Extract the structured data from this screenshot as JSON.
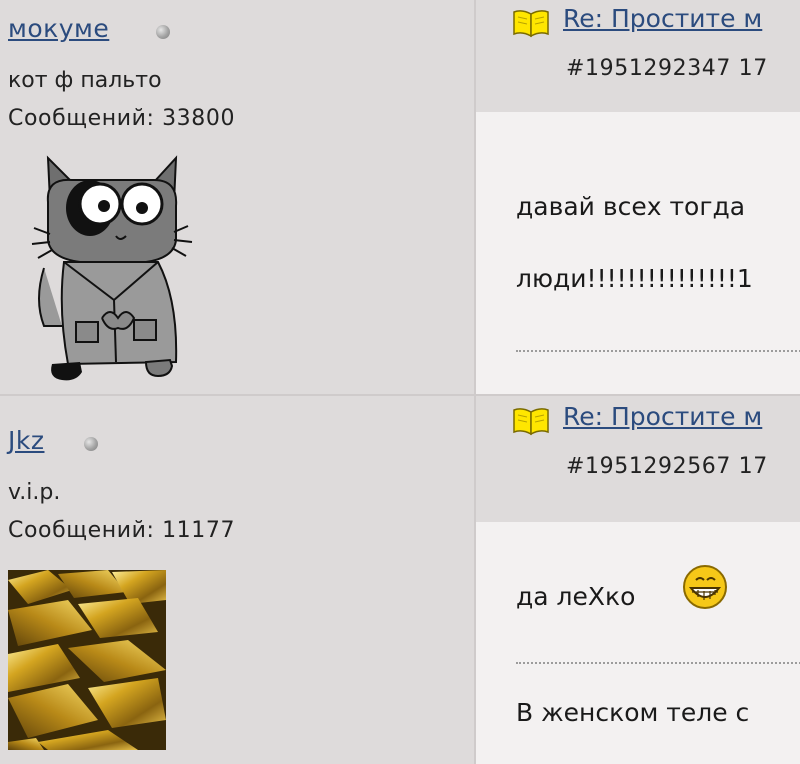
{
  "posts": [
    {
      "author": "мокуме",
      "rank": "кот ф пальто",
      "message_count": "Сообщений: 33800",
      "avatar_icon": "cat-in-coat-avatar",
      "title": "Re: Простите м",
      "post_number": "#1951292347 17",
      "lines": [
        "давай всех тогда",
        "люди!!!!!!!!!!!!!!!1"
      ]
    },
    {
      "author": "Jkz",
      "rank": "v.i.p.",
      "message_count": "Сообщений: 11177",
      "avatar_icon": "gold-bars-avatar",
      "title": "Re: Простите м",
      "post_number": "#1951292567 17",
      "lines": [
        "да леХко",
        "В женском теле с"
      ],
      "smiley_icon": "grin-smiley-icon"
    }
  ],
  "colors": {
    "link": "#2b4b7e",
    "background": "#dedbdb",
    "post_body": "#f3f1f1"
  }
}
